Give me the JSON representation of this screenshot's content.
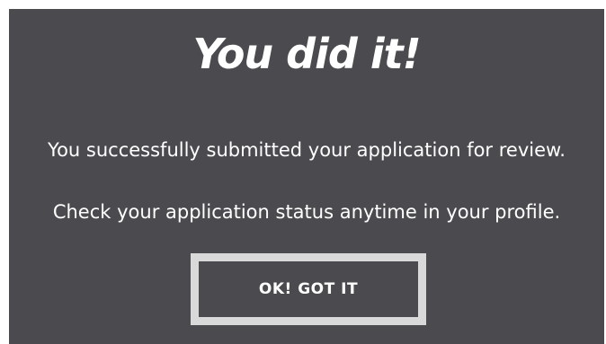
{
  "dialog": {
    "title": "You did it!",
    "message_1": "You successfully submitted your application for review.",
    "message_2": "Check your application status anytime in your profile.",
    "ok_button_label": "OK! GOT IT"
  },
  "colors": {
    "background": "#4b4b4f",
    "text": "#ffffff",
    "button_border": "#d9d9d9"
  }
}
